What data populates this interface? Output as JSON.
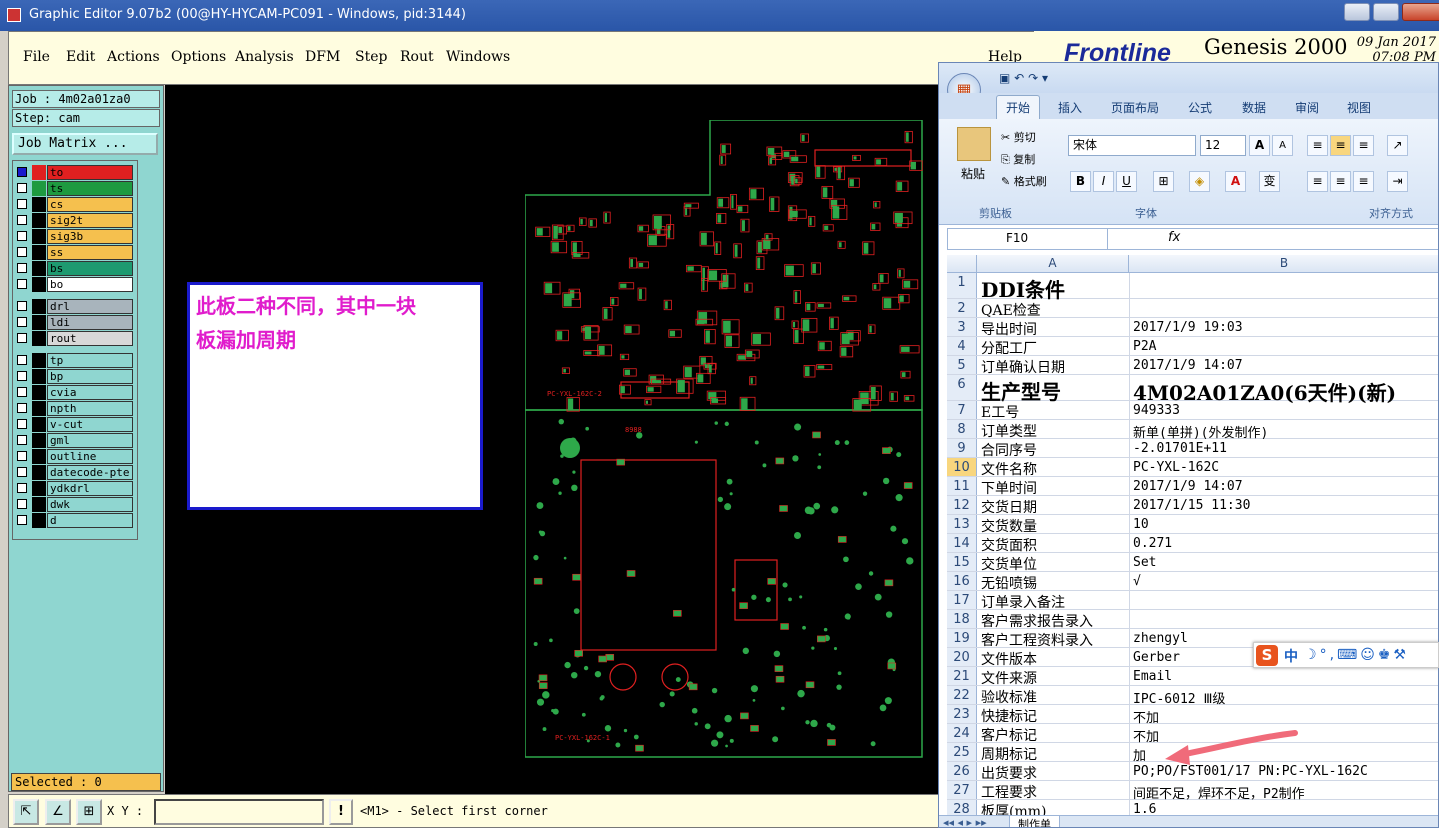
{
  "window": {
    "title": "Graphic Editor 9.07b2 (00@HY-HYCAM-PC091 - Windows, pid:3144)"
  },
  "menu": {
    "items": [
      "File",
      "Edit",
      "Actions",
      "Options",
      "Analysis",
      "DFM",
      "Step",
      "Rout",
      "Windows"
    ],
    "help": "Help"
  },
  "logo": {
    "brand": "Frontline",
    "product": "Genesis 2000",
    "date": "09 Jan 2017",
    "time": "07:08 PM"
  },
  "job": {
    "job_label": "Job : 4m02a01za0",
    "step_label": "Step: cam",
    "matrix_button": "Job Matrix ..."
  },
  "layers": {
    "group1": [
      {
        "name": "to",
        "color": "#e02020",
        "icons": "✐⊞"
      },
      {
        "name": "ts",
        "color": "#1e9a40",
        "icons": ""
      },
      {
        "name": "cs",
        "color": "#f5c04e",
        "icons": "✐"
      },
      {
        "name": "sig2t",
        "color": "#f5c04e",
        "icons": "✐"
      },
      {
        "name": "sig3b",
        "color": "#f5c04e",
        "icons": "✐"
      },
      {
        "name": "ss",
        "color": "#f5c04e",
        "icons": "✐"
      },
      {
        "name": "bs",
        "color": "#1e9a70",
        "icons": ""
      },
      {
        "name": "bo",
        "color": "#ffffff",
        "icons": ""
      }
    ],
    "group2": [
      {
        "name": "drl",
        "color": "#a8b4bc"
      },
      {
        "name": "ldi",
        "color": "#a8b4bc"
      },
      {
        "name": "rout",
        "color": "#d8d8d8"
      }
    ],
    "group3": [
      "tp",
      "bp",
      "cvia",
      "npth",
      "v-cut",
      "gml",
      "outline",
      "datecode-pte",
      "ydkdrl",
      "dwk",
      "d"
    ],
    "group3_color": "#8fd6d0"
  },
  "status": {
    "selected": "Selected : 0",
    "xy_label": "X Y :",
    "xy_value": "",
    "message": "<M1> - Select first corner",
    "warn_button": "!"
  },
  "note": {
    "line1": "此板二种不同，其中一块",
    "line2": "板漏加周期"
  },
  "pcb": {
    "label_top": "PC-YXL-162C-2",
    "label_bottom": "PC-YXL-162C-1",
    "code": "8988"
  },
  "excel": {
    "tabs": [
      "开始",
      "插入",
      "页面布局",
      "公式",
      "数据",
      "审阅",
      "视图"
    ],
    "clipboard": {
      "paste": "粘贴",
      "cut": "剪切",
      "copy": "复制",
      "format": "格式刷",
      "group": "剪贴板"
    },
    "font": {
      "name": "宋体",
      "size": "12",
      "group": "字体",
      "grow": "A",
      "shrink": "A",
      "bold": "B",
      "italic": "I",
      "underline": "U",
      "fontcolor": "A",
      "phonetic": "变"
    },
    "align_group": "对齐方式",
    "cell_ref": "F10",
    "fx": "fx",
    "columns": [
      "A",
      "B"
    ],
    "sheet_tab": "制作单",
    "rows": [
      {
        "n": "1",
        "a": "DDI条件",
        "b": "",
        "big": true
      },
      {
        "n": "2",
        "a": "QAE检查",
        "b": ""
      },
      {
        "n": "3",
        "a": "导出时间",
        "b": "2017/1/9 19:03"
      },
      {
        "n": "4",
        "a": "分配工厂",
        "b": "P2A"
      },
      {
        "n": "5",
        "a": "订单确认日期",
        "b": "2017/1/9 14:07"
      },
      {
        "n": "6",
        "a": "生产型号",
        "b": "4M02A01ZA0(6天件)(新)",
        "big": true
      },
      {
        "n": "7",
        "a": "E工号",
        "b": "949333"
      },
      {
        "n": "8",
        "a": "订单类型",
        "b": "新单(单拼)(外发制作)"
      },
      {
        "n": "9",
        "a": "合同序号",
        "b": "-2.01701E+11"
      },
      {
        "n": "10",
        "a": "文件名称",
        "b": "PC-YXL-162C",
        "sel": true
      },
      {
        "n": "11",
        "a": "下单时间",
        "b": "2017/1/9 14:07"
      },
      {
        "n": "12",
        "a": "交货日期",
        "b": "2017/1/15 11:30"
      },
      {
        "n": "13",
        "a": "交货数量",
        "b": "10"
      },
      {
        "n": "14",
        "a": "交货面积",
        "b": "0.271"
      },
      {
        "n": "15",
        "a": "交货单位",
        "b": "Set"
      },
      {
        "n": "16",
        "a": "无铅喷锡",
        "b": "√"
      },
      {
        "n": "17",
        "a": "订单录入备注",
        "b": ""
      },
      {
        "n": "18",
        "a": "客户需求报告录入",
        "b": ""
      },
      {
        "n": "19",
        "a": "客户工程资料录入",
        "b": "zhengyl"
      },
      {
        "n": "20",
        "a": "文件版本",
        "b": "Gerber"
      },
      {
        "n": "21",
        "a": "文件来源",
        "b": "Email"
      },
      {
        "n": "22",
        "a": "验收标准",
        "b": "IPC-6012 Ⅲ级"
      },
      {
        "n": "23",
        "a": "快捷标记",
        "b": "不加"
      },
      {
        "n": "24",
        "a": "客户标记",
        "b": "不加"
      },
      {
        "n": "25",
        "a": "周期标记",
        "b": "加"
      },
      {
        "n": "26",
        "a": "出货要求",
        "b": "PO;PO/FST001/17 PN:PC-YXL-162C"
      },
      {
        "n": "27",
        "a": "工程要求",
        "b": "间距不足，焊环不足，P2制作"
      },
      {
        "n": "28",
        "a": "板厚(mm)",
        "b": "1.6"
      }
    ]
  },
  "ime": {
    "logo": "S",
    "mode": "中"
  }
}
